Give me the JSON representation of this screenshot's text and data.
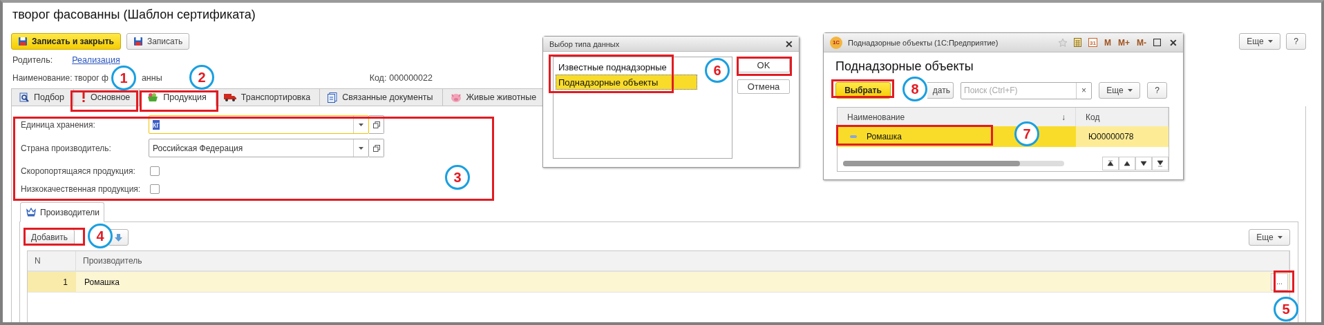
{
  "form": {
    "title": "творог фасованны (Шаблон сертификата)",
    "buttons": [
      {
        "label": "Записать и закрыть",
        "kind": "primary"
      },
      {
        "label": "Записать",
        "kind": "default"
      }
    ],
    "more": "Еще",
    "help": "?",
    "parent": {
      "label": "Родитель:",
      "value": "Реализация"
    },
    "name": {
      "label": "Наименование:",
      "value_parts": [
        "творог ф",
        "анны"
      ]
    },
    "code": {
      "label": "Код:",
      "value": "000000022"
    },
    "tabs": [
      {
        "label": "Подбор",
        "selected": false
      },
      {
        "label": "Основное",
        "selected": false
      },
      {
        "label": "Продукция",
        "selected": true
      },
      {
        "label": "Транспортировка",
        "selected": false
      },
      {
        "label": "Связанные документы",
        "selected": false
      },
      {
        "label": "Живые животные",
        "selected": false
      }
    ],
    "fields": [
      {
        "kind": "select",
        "label": "Единица хранения:",
        "value": "кг",
        "focused": true
      },
      {
        "kind": "select",
        "label": "Страна производитель:",
        "value": "Российская Федерация",
        "focused": false
      },
      {
        "kind": "checkbox",
        "label": "Скоропортящаяся продукция:",
        "checked": false
      },
      {
        "kind": "checkbox",
        "label": "Низкокачественная продукция:",
        "checked": false
      }
    ],
    "subtab": {
      "label": "Производители",
      "selected": true
    },
    "add": "Добавить",
    "table_more": "Еще",
    "columns": [
      "N",
      "Производитель"
    ],
    "rows": [
      {
        "n": "1",
        "name": "Ромашка",
        "selected": true,
        "action": "..."
      }
    ]
  },
  "type_dialog": {
    "title": "Выбор типа данных",
    "close": "✕",
    "items": [
      {
        "label": "Известные поднадзорные",
        "selected": false
      },
      {
        "label": "Поднадзорные объекты",
        "selected": true
      }
    ],
    "ok": "OK",
    "cancel": "Отмена"
  },
  "objects_window": {
    "logo": "1С",
    "title": "Поднадзорные объекты  (1С:Предприятие)",
    "calendar_day": "31",
    "memory_buttons": [
      "M",
      "M+",
      "M-"
    ],
    "close": "✕",
    "heading": "Поднадзорные объекты",
    "choose": "Выбрать",
    "create": "дать",
    "search_placeholder": "Поиск (Ctrl+F)",
    "clear": "×",
    "more": "Еще",
    "help": "?",
    "columns": [
      {
        "label": "Наименование",
        "sort": "↓"
      },
      {
        "label": "Код"
      }
    ],
    "rows": [
      {
        "name": "Ромашка",
        "code": "Ю00000078",
        "selected": true
      }
    ]
  },
  "markers": [
    {
      "number": "1"
    },
    {
      "number": "2"
    },
    {
      "number": "3"
    },
    {
      "number": "4"
    },
    {
      "number": "5"
    },
    {
      "number": "6"
    },
    {
      "number": "7"
    },
    {
      "number": "8"
    }
  ]
}
